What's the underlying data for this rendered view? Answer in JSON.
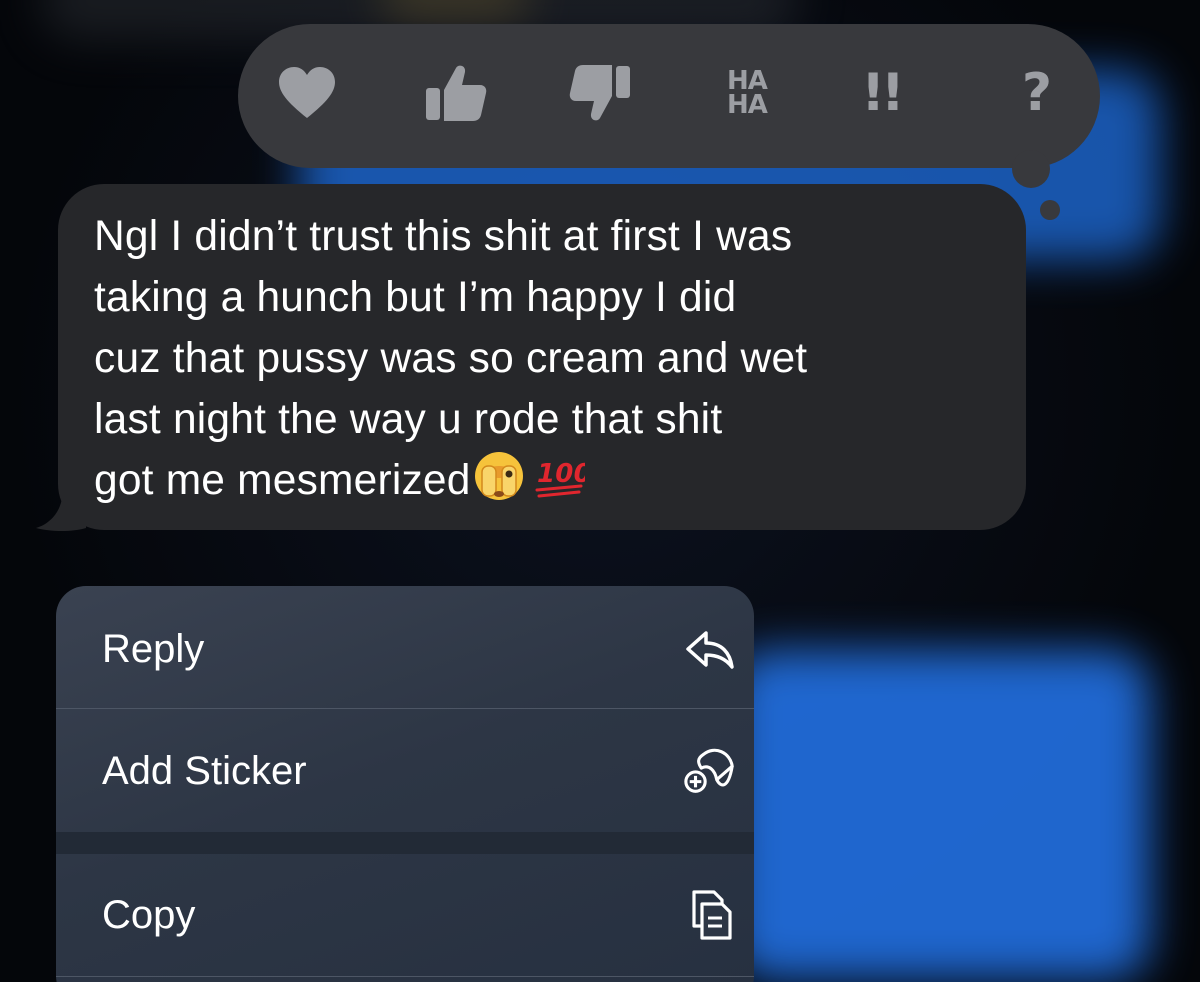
{
  "tapback": {
    "reactions": [
      {
        "name": "heart-icon"
      },
      {
        "name": "thumbs-up-icon"
      },
      {
        "name": "thumbs-down-icon"
      },
      {
        "name": "haha-icon",
        "line1": "HA",
        "line2": "HA"
      },
      {
        "name": "exclamation-icon",
        "text": "!!"
      },
      {
        "name": "question-icon",
        "text": "?"
      }
    ]
  },
  "message": {
    "text": "Ngl I didn’t trust this shit at first I was\ntaking a hunch but I’m happy I did\ncuz that pussy was so cream and wet\nlast night  the way u rode that shit\ngot me mesmerized"
  },
  "menu": {
    "items": [
      {
        "label": "Reply",
        "icon": "reply-icon"
      },
      {
        "label": "Add Sticker",
        "icon": "add-sticker-icon"
      },
      {
        "label": "Copy",
        "icon": "copy-icon"
      }
    ]
  },
  "colors": {
    "tapback_bg": "#38393d",
    "reaction_icon": "#9c9ea3",
    "bubble_bg": "#26272a",
    "menu_bg": "#2d3645",
    "blur_blue": "#1f6fe0"
  }
}
